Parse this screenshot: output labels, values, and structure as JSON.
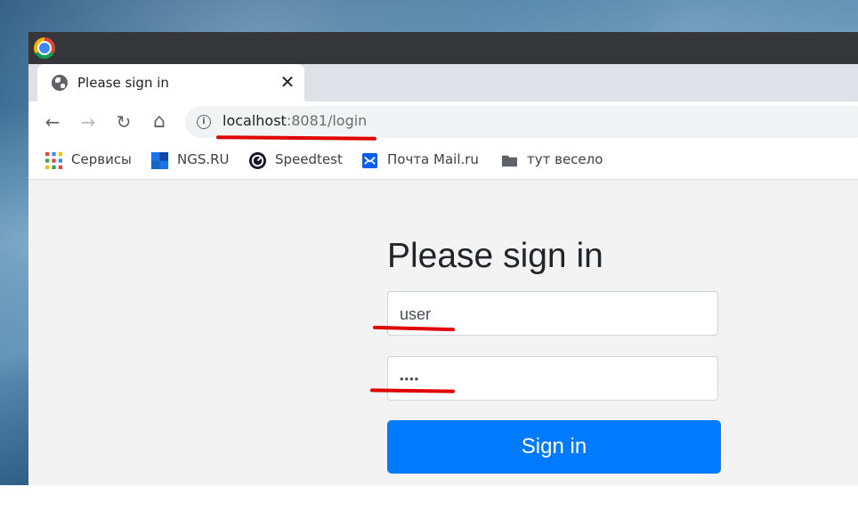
{
  "browser": {
    "tab": {
      "title": "Please sign in",
      "close_glyph": "✕",
      "favicon": "globe-icon"
    },
    "nav": {
      "back": "←",
      "forward": "→",
      "reload": "↻",
      "home": "⌂"
    },
    "address": {
      "host": "localhost",
      "rest": ":8081/login",
      "info_glyph": "i"
    },
    "bookmarks": [
      {
        "label": "Сервисы",
        "icon": "apps-grid-icon",
        "color": "#ea4335"
      },
      {
        "label": "NGS.RU",
        "icon": "ngs-icon",
        "color": "#1a73e8"
      },
      {
        "label": "Speedtest",
        "icon": "speedtest-icon",
        "color": "#141526"
      },
      {
        "label": "Почта Mail.ru",
        "icon": "mail-icon",
        "color": "#005ff9"
      },
      {
        "label": "тут весело",
        "icon": "folder-icon",
        "color": "#5f6368"
      }
    ]
  },
  "login": {
    "heading": "Please sign in",
    "username": "user",
    "password_mask": "••••",
    "submit_label": "Sign in",
    "button_color": "#007bff"
  },
  "annotation_color": "#e00000"
}
